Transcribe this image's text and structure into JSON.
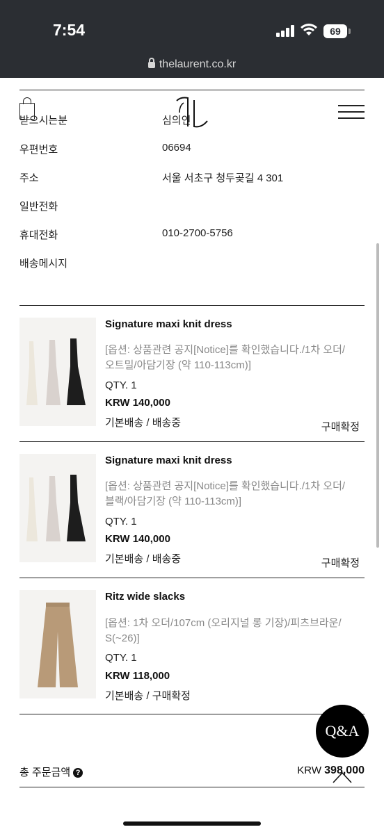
{
  "status_bar": {
    "time": "7:54",
    "battery": "69"
  },
  "browser": {
    "url": "thelaurent.co.kr"
  },
  "recipient": [
    {
      "label": "받으시는분",
      "value": "심의인"
    },
    {
      "label": "우편번호",
      "value": "06694"
    },
    {
      "label": "주소",
      "value": "서울 서초구 청두곶길 4 301"
    },
    {
      "label": "일반전화",
      "value": ""
    },
    {
      "label": "휴대전화",
      "value": "010-2700-5756"
    },
    {
      "label": "배송메시지",
      "value": ""
    }
  ],
  "items": [
    {
      "name": "Signature maxi knit dress",
      "option_line1": "[옵션: 상품관련 공지[Notice]를 확인했습니다./1차 오더/",
      "option_line2": "오트밀/아담기장 (약 110-113cm)]",
      "qty": "QTY. 1",
      "price": "KRW 140,000",
      "shipping": "기본배송 / 배송중",
      "status": "구매확정",
      "image": "dress-trio"
    },
    {
      "name": "Signature maxi knit dress",
      "option_line1": "[옵션: 상품관련 공지[Notice]를 확인했습니다./1차 오더/",
      "option_line2": "블랙/아담기장 (약 110-113cm)]",
      "qty": "QTY. 1",
      "price": "KRW 140,000",
      "shipping": "기본배송 / 배송중",
      "status": "구매확정",
      "image": "dress-trio"
    },
    {
      "name": "Ritz wide slacks",
      "option_line1": "[옵션: 1차 오더/107cm (오리지널 롱 기장)/피츠브라운/",
      "option_line2": "S(~26)]",
      "qty": "QTY. 1",
      "price": "KRW 118,000",
      "shipping": "기본배송 / 구매확정",
      "status": "",
      "image": "brown-slacks"
    }
  ],
  "qa_button": "Q&A",
  "total": {
    "label": "총 주문금액",
    "help_icon": "?",
    "currency": "KRW",
    "amount": "398,000"
  },
  "colors": {
    "status_bar_bg": "#2b2e33",
    "divider": "#222222",
    "option_text": "#888888",
    "slacks": "#b89a78"
  }
}
